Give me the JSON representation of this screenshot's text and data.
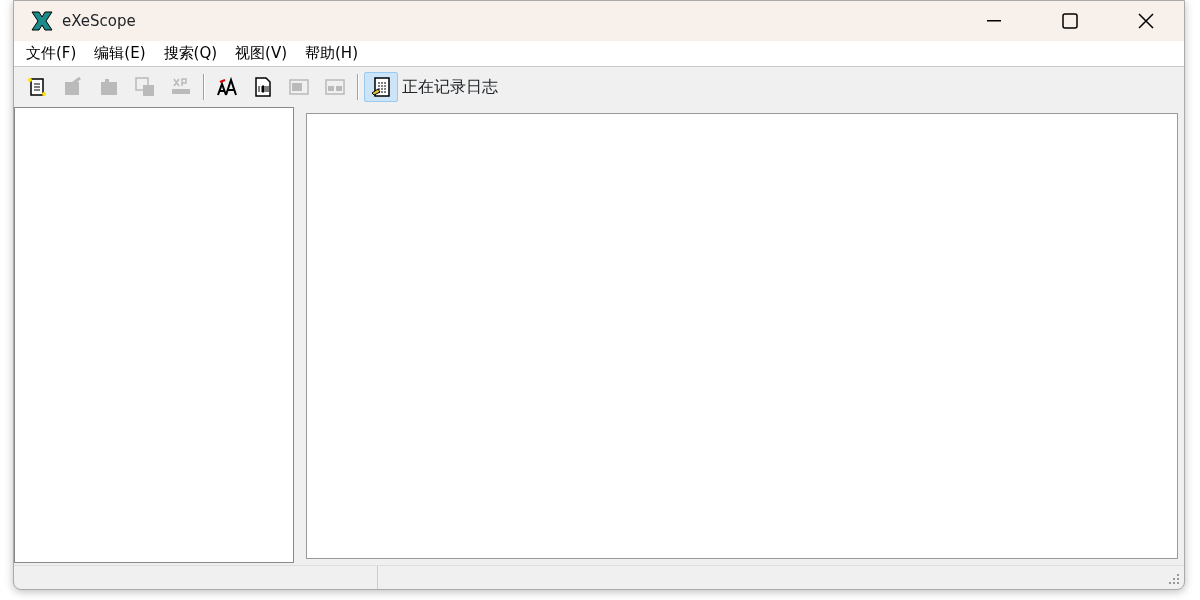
{
  "window": {
    "title": "eXeScope"
  },
  "menu": [
    {
      "label": "文件(F)"
    },
    {
      "label": "编辑(E)"
    },
    {
      "label": "搜索(Q)"
    },
    {
      "label": "视图(V)"
    },
    {
      "label": "帮助(H)"
    }
  ],
  "toolbar": [
    {
      "kind": "open",
      "disabled": false
    },
    {
      "kind": "export",
      "disabled": true
    },
    {
      "kind": "import",
      "disabled": true
    },
    {
      "kind": "copy",
      "disabled": true
    },
    {
      "kind": "xp",
      "disabled": true
    },
    {
      "kind": "separator"
    },
    {
      "kind": "font",
      "disabled": false
    },
    {
      "kind": "binary",
      "disabled": false
    },
    {
      "kind": "dialog",
      "disabled": true
    },
    {
      "kind": "form",
      "disabled": true
    },
    {
      "kind": "separator"
    },
    {
      "kind": "log",
      "disabled": false,
      "pressed": true
    }
  ],
  "log_status": "正在记录日志"
}
